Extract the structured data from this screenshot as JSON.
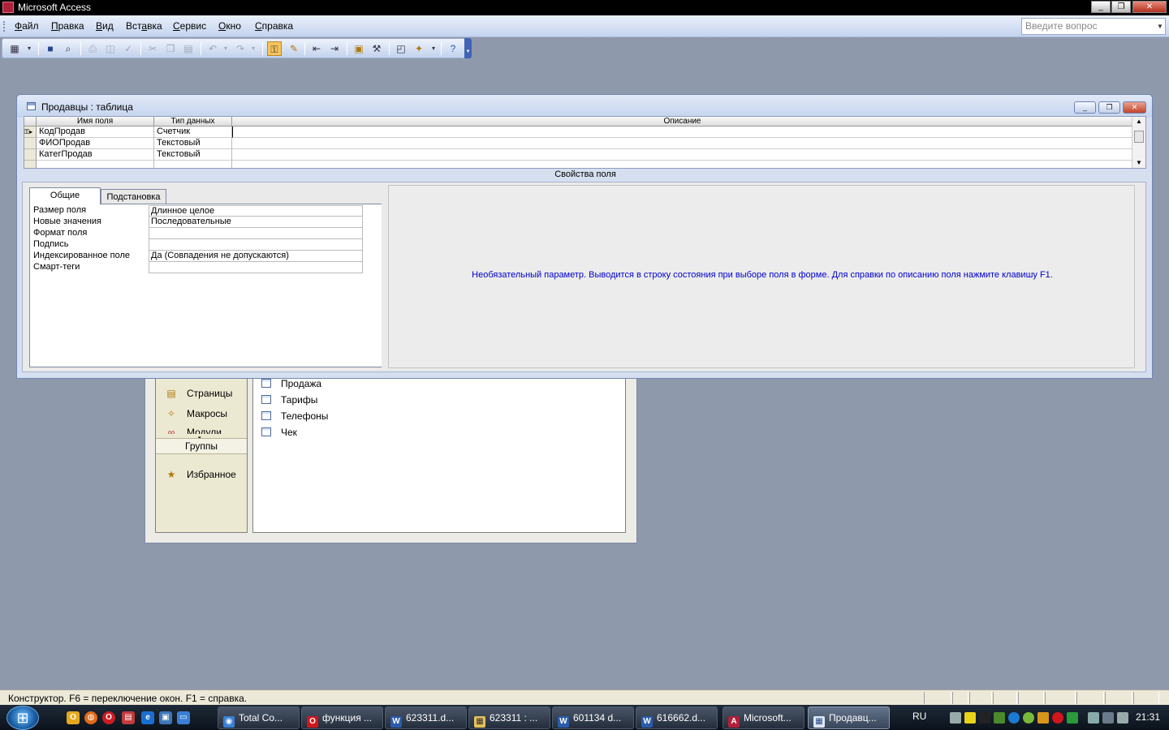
{
  "window": {
    "title": "Microsoft Access",
    "minimize_label": "_",
    "restore_label": "❐",
    "close_label": "✕"
  },
  "menu": {
    "items": [
      {
        "underline": "Ф",
        "rest": "айл"
      },
      {
        "underline": "П",
        "rest": "равка"
      },
      {
        "underline": "В",
        "rest": "ид"
      },
      {
        "underline": "",
        "rest": "Вст",
        "underline2": "а",
        "rest2": "вка"
      },
      {
        "underline": "С",
        "rest": "ервис"
      },
      {
        "underline": "О",
        "rest": "кно"
      },
      {
        "underline": "С",
        "rest": "правка"
      }
    ],
    "ask_placeholder": "Введите вопрос"
  },
  "toolbar": {
    "icons": [
      "view-icon",
      "save-icon",
      "search-file-icon",
      "print-icon",
      "print-preview-icon",
      "spelling-icon",
      "cut-icon",
      "copy-icon",
      "paste-icon",
      "undo-icon",
      "redo-icon",
      "primary-key-icon",
      "build-icon",
      "insert-rows-icon",
      "delete-rows-icon",
      "properties-icon",
      "build-icon-2",
      "database-window-icon",
      "new-object-icon",
      "help-icon"
    ]
  },
  "table_window": {
    "title": "Продавцы : таблица",
    "columns": {
      "field_name": "Имя поля",
      "data_type": "Тип данных",
      "description": "Описание"
    },
    "rows": [
      {
        "field": "КодПродав",
        "type": "Счетчик",
        "description": ""
      },
      {
        "field": "ФИОПродав",
        "type": "Текстовый",
        "description": ""
      },
      {
        "field": "КатегПродав",
        "type": "Текстовый",
        "description": ""
      }
    ],
    "properties_label": "Свойства поля",
    "tabs": {
      "general": "Общие",
      "lookup": "Подстановка"
    },
    "properties": [
      {
        "label": "Размер поля",
        "value": "Длинное целое"
      },
      {
        "label": "Новые значения",
        "value": "Последовательные"
      },
      {
        "label": "Формат поля",
        "value": ""
      },
      {
        "label": "Подпись",
        "value": ""
      },
      {
        "label": "Индексированное поле",
        "value": "Да (Совпадения не допускаются)"
      },
      {
        "label": "Смарт-теги",
        "value": ""
      }
    ],
    "help_text": "Необязательный параметр.  Выводится в строку состояния при выборе поля в форме.  Для справки по описанию поля нажмите клавишу F1."
  },
  "database_window": {
    "objects": [
      {
        "label": "Страницы",
        "icon": "pages-icon"
      },
      {
        "label": "Макросы",
        "icon": "macros-icon"
      },
      {
        "label": "Модули",
        "icon": "modules-icon"
      }
    ],
    "groups_label": "Группы",
    "favorites_label": "Избранное",
    "tables": [
      "Продажа",
      "Тарифы",
      "Телефоны",
      "Чек"
    ]
  },
  "status_bar": {
    "text": "Конструктор.  F6 = переключение окон.  F1 = справка."
  },
  "taskbar": {
    "tasks": [
      {
        "label": "Total Co...",
        "icon_color": "#3a7fd5",
        "icon_text": "◉"
      },
      {
        "label": "функция ...",
        "icon_color": "#d0161c",
        "icon_text": "O"
      },
      {
        "label": "623311.d...",
        "icon_color": "#2a5caa",
        "icon_text": "W"
      },
      {
        "label": "623311 : ...",
        "icon_color": "#e7c15a",
        "icon_text": "▦"
      },
      {
        "label": "601134 d...",
        "icon_color": "#2a5caa",
        "icon_text": "W"
      },
      {
        "label": "616662.d...",
        "icon_color": "#2a5caa",
        "icon_text": "W"
      },
      {
        "label": "Microsoft...",
        "icon_color": "#b0203a",
        "icon_text": "A"
      },
      {
        "label": "Продавц...",
        "icon_color": "#dfe8f7",
        "icon_text": "▦"
      }
    ],
    "language": "RU",
    "clock": "21:31"
  }
}
